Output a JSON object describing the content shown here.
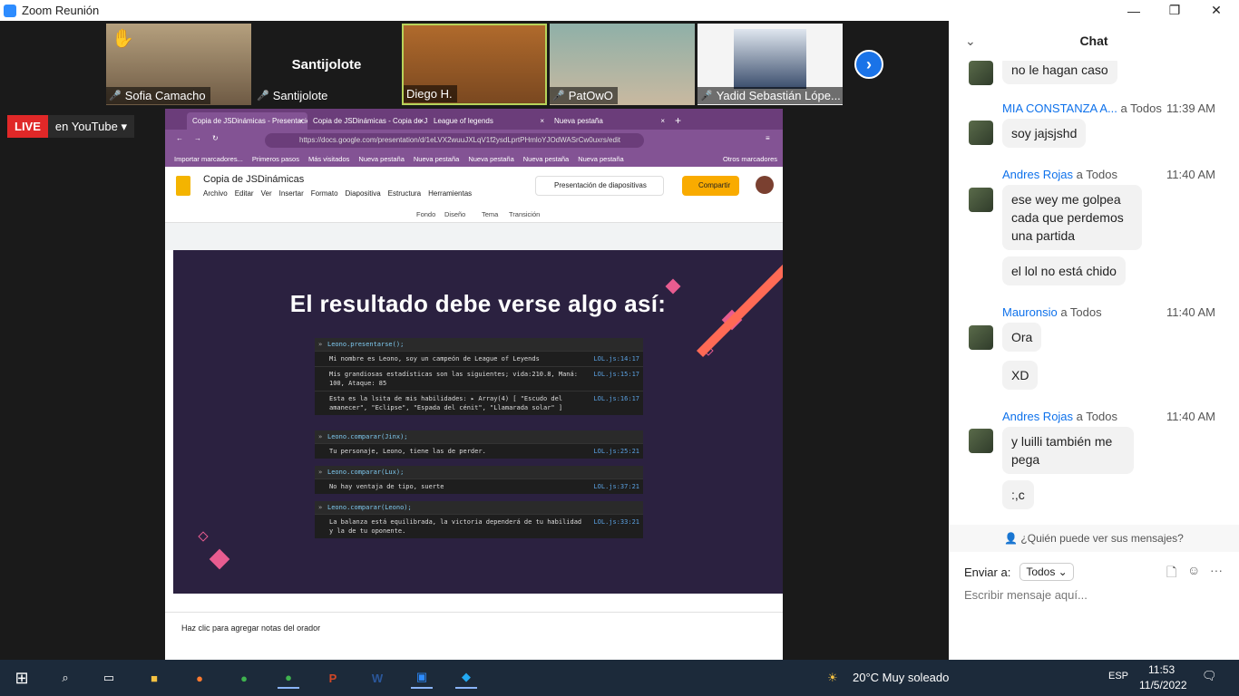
{
  "window": {
    "title": "Zoom Reunión"
  },
  "participants": [
    {
      "name": "Sofia Camacho"
    },
    {
      "name": "Santijolote",
      "display": "Santijolote"
    },
    {
      "name": "Diego H."
    },
    {
      "name": "PatOwO"
    },
    {
      "name": "Yadid Sebastián Lópe..."
    }
  ],
  "live": {
    "badge": "LIVE",
    "platform": "en YouTube"
  },
  "browser": {
    "tabs": [
      "Copia de JSDinámicas - Presentación",
      "Copia de JSDinámicas - Copia de JS",
      "League of legends",
      "Nueva pestaña"
    ],
    "url": "https://docs.google.com/presentation/d/1eLVX2wuuJXLqV1f2ysdLprtPHmloYJOdWASrCw0uxrs/edit",
    "bookmarks": [
      "Importar marcadores...",
      "Primeros pasos",
      "Más visitados",
      "Nueva pestaña",
      "Nueva pestaña",
      "Nueva pestaña",
      "Nueva pestaña",
      "Nueva pestaña"
    ],
    "other_bookmarks": "Otros marcadores"
  },
  "slides": {
    "doc_title": "Copia de JSDinámicas",
    "menu": [
      "Archivo",
      "Editar",
      "Ver",
      "Insertar",
      "Formato",
      "Diapositiva",
      "Estructura",
      "Herramientas"
    ],
    "present_label": "Presentación de diapositivas",
    "share_label": "Compartir",
    "toolbar": [
      "Fondo",
      "Diseño",
      "Tema",
      "Transición"
    ],
    "slide_title": "El resultado debe verse algo así:",
    "console": [
      {
        "cmd": "Leono.presentarse();",
        "outputs": [
          {
            "text": "Mi nombre es Leono, soy un campeón de League of Leyends",
            "src": "LOL.js:14:17"
          },
          {
            "text": "Mis grandiosas estadísticas son las siguientes; vida:210.8, Maná: 100, Ataque: 85",
            "src": "LOL.js:15:17"
          },
          {
            "text": "Esta es la lsita de mis habilidades: ▸ Array(4) [ \"Escudo del amanecer\", \"Eclipse\", \"Espada del cénit\", \"Llamarada solar\" ]",
            "src": "LOL.js:16:17"
          }
        ]
      },
      {
        "cmd": "Leono.comparar(Jinx);",
        "outputs": [
          {
            "text": "Tu personaje, Leono, tiene las de perder.",
            "src": "LOL.js:25:21"
          }
        ]
      },
      {
        "cmd": "Leono.comparar(Lux);",
        "outputs": [
          {
            "text": "No hay ventaja de tipo, suerte",
            "src": "LOL.js:37:21"
          }
        ]
      },
      {
        "cmd": "Leono.comparar(Leono);",
        "outputs": [
          {
            "text": "La balanza está equilibrada, la victoria dependerá de tu habilidad y la de tu oponente.",
            "src": "LOL.js:33:21"
          }
        ]
      }
    ],
    "notes": "Haz clic para agregar notas del orador"
  },
  "chat": {
    "title": "Chat",
    "messages": [
      {
        "sender": "",
        "to": "",
        "time": "",
        "text": "no le hagan caso"
      },
      {
        "sender": "MIA CONSTANZA A...",
        "to": "a Todos",
        "time": "11:39 AM",
        "text": "soy jajsjshd"
      },
      {
        "sender": "Andres Rojas",
        "to": "a Todos",
        "time": "11:40 AM",
        "text": "ese wey me golpea cada que perdemos una partida"
      },
      {
        "sender": "",
        "to": "",
        "time": "",
        "text": "el lol no está chido"
      },
      {
        "sender": "Mauronsio",
        "to": "a Todos",
        "time": "11:40 AM",
        "text": "Ora"
      },
      {
        "sender": "",
        "to": "",
        "time": "",
        "text": "XD"
      },
      {
        "sender": "Andres Rojas",
        "to": "a Todos",
        "time": "11:40 AM",
        "text": "y luilli también me pega"
      },
      {
        "sender": "",
        "to": "",
        "time": "",
        "text": ":,c"
      }
    ],
    "who_can_see": "¿Quién puede ver sus mensajes?",
    "send_to_label": "Enviar a:",
    "send_to_value": "Todos",
    "input_placeholder": "Escribir mensaje aquí..."
  },
  "taskbar": {
    "weather": "20°C  Muy soleado",
    "lang": "ESP",
    "time": "11:53",
    "date": "11/5/2022"
  }
}
